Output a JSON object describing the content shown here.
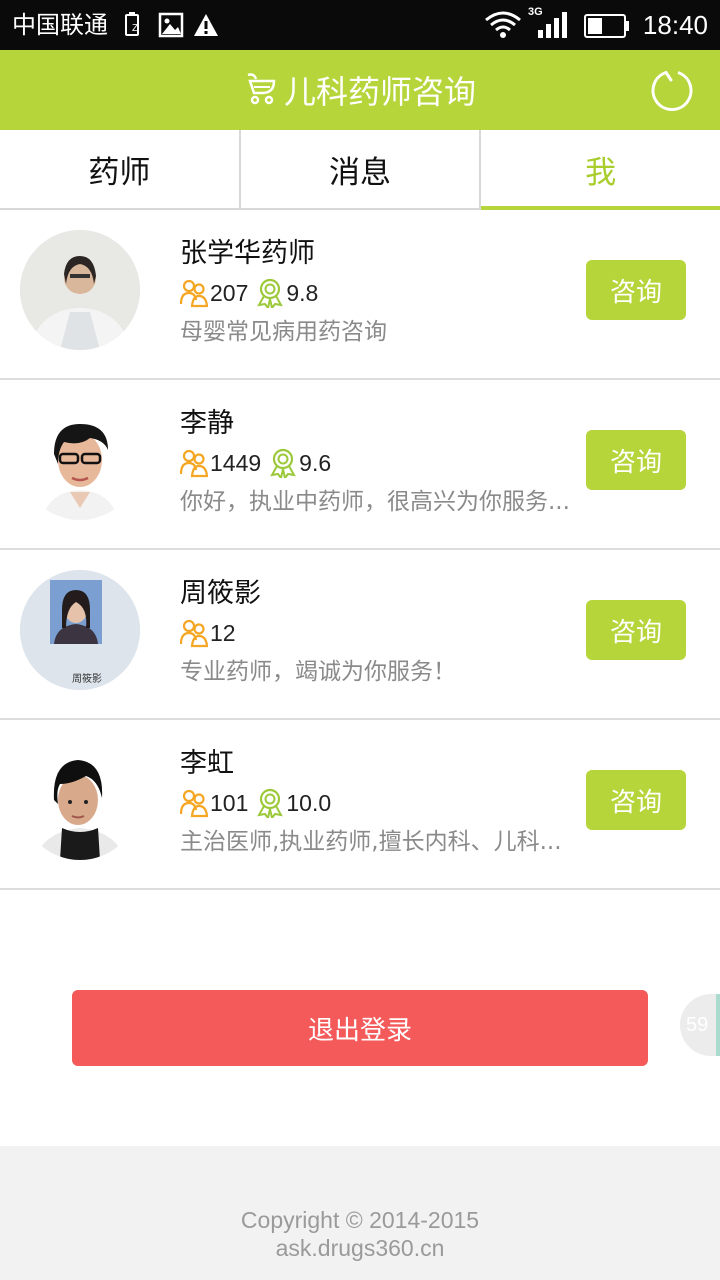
{
  "status_bar": {
    "carrier": "中国联通",
    "network": "3G",
    "time": "18:40"
  },
  "header": {
    "title": "儿科药师咨询",
    "brand_icon": "stroller-icon",
    "refresh_icon": "refresh-icon"
  },
  "tabs": [
    {
      "label": "药师",
      "active": false
    },
    {
      "label": "消息",
      "active": false
    },
    {
      "label": "我",
      "active": true
    }
  ],
  "pharmacists": [
    {
      "name": "张学华药师",
      "consults": "207",
      "rating": "9.8",
      "desc": "母婴常见病用药咨询",
      "button": "咨询"
    },
    {
      "name": "李静",
      "consults": "1449",
      "rating": "9.6",
      "desc": "你好，执业中药师，很高兴为你服务...",
      "button": "咨询"
    },
    {
      "name": "周筱影",
      "consults": "12",
      "rating": "",
      "desc": "专业药师，竭诚为你服务！",
      "button": "咨询"
    },
    {
      "name": "李虹",
      "consults": "101",
      "rating": "10.0",
      "desc": "主治医师,执业药师,擅长内科、儿科...",
      "button": "咨询"
    }
  ],
  "logout": {
    "label": "退出登录"
  },
  "float_badge": "59",
  "footer": {
    "copyright": "Copyright © 2014-2015",
    "site": "ask.drugs360.cn"
  },
  "colors": {
    "brand_green": "#b5d53b",
    "logout_red": "#f45a5a",
    "badge_orange": "#f5a623"
  }
}
